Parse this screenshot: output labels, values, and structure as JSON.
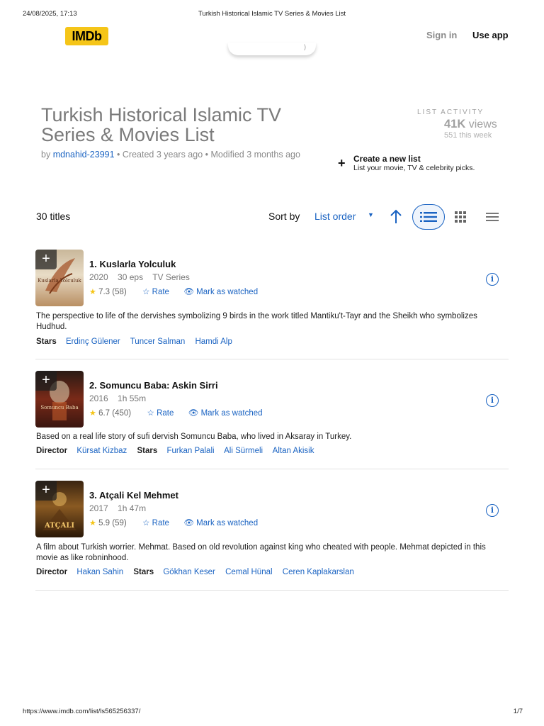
{
  "print": {
    "date": "24/08/2025, 17:13",
    "title": "Turkish Historical Islamic TV Series & Movies List",
    "url": "https://www.imdb.com/list/ls565256337/",
    "page": "1/7"
  },
  "header": {
    "logo": "IMDb",
    "sign_in": "Sign in",
    "use_app": "Use app"
  },
  "list": {
    "title": "Turkish Historical Islamic TV Series & Movies List",
    "by": "by",
    "author": "mdnahid-23991",
    "meta": " • Created 3 years ago • Modified 3 months ago"
  },
  "activity": {
    "label": "LIST ACTIVITY",
    "views_count": "41K",
    "views_label": "views",
    "this_week": "551 this week"
  },
  "create": {
    "title": "Create a new list",
    "subtitle": "List your movie, TV & celebrity picks."
  },
  "toolbar": {
    "count": "30 titles",
    "sort_by": "Sort by",
    "sort_value": "List order"
  },
  "icons": {
    "plus": "plus-icon",
    "sort_direction": "arrow-up-icon",
    "view_detailed": "list-view-icon",
    "view_grid": "grid-view-icon",
    "view_compact": "compact-view-icon",
    "info": "info-icon",
    "star": "star-icon",
    "rate": "star-outline-icon",
    "watch": "eye-icon"
  },
  "colors": {
    "brand": "#f5c518",
    "link": "#1a63c2"
  },
  "items": [
    {
      "title": "1. Kuslarla Yolculuk",
      "year": "2020",
      "duration": "30 eps",
      "type": "TV Series",
      "rating": "7.3",
      "votes": "(58)",
      "rate": "Rate",
      "watch": "Mark as watched",
      "poster_text": "Kuslarla Yolculuk",
      "description": "The perspective to life of the dervishes symbolizing 9 birds in the work titled Mantiku't-Tayr and the Sheikh who symbolizes Hudhud.",
      "stars_label": "Stars",
      "stars": [
        "Erdinç Gülener",
        "Tuncer Salman",
        "Hamdi Alp"
      ]
    },
    {
      "title": "2. Somuncu Baba: Askin Sirri",
      "year": "2016",
      "duration": "1h 55m",
      "type": "",
      "rating": "6.7",
      "votes": "(450)",
      "rate": "Rate",
      "watch": "Mark as watched",
      "poster_text": "Somuncu Baba",
      "description": "Based on a real life story of sufi dervish Somuncu Baba, who lived in Aksaray in Turkey.",
      "director_label": "Director",
      "director": "Kürsat Kizbaz",
      "stars_label": "Stars",
      "stars": [
        "Furkan Palali",
        "Ali Sürmeli",
        "Altan Akisik"
      ]
    },
    {
      "title": "3. Atçali Kel Mehmet",
      "year": "2017",
      "duration": "1h 47m",
      "type": "",
      "rating": "5.9",
      "votes": "(59)",
      "rate": "Rate",
      "watch": "Mark as watched",
      "poster_text": "ATÇALI",
      "description": "A film about Turkish worrier. Mehmat. Based on old revolution against king who cheated with people. Mehmat depicted in this movie as like robninhood.",
      "director_label": "Director",
      "director": "Hakan Sahin",
      "stars_label": "Stars",
      "stars": [
        "Gökhan Keser",
        "Cemal Hünal",
        "Ceren Kaplakarslan"
      ]
    }
  ]
}
